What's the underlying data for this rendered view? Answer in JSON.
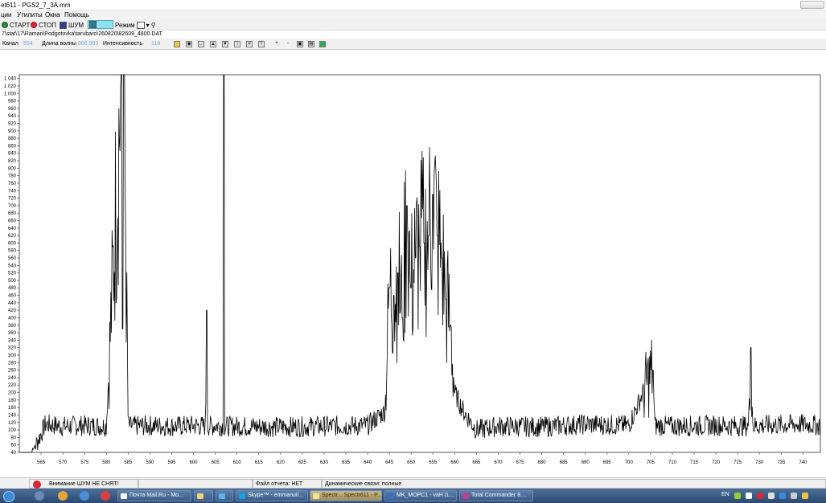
{
  "window": {
    "title": "et611 - PGS2_7_3A.mm"
  },
  "menu": [
    "ции",
    "Утилиты",
    "Окна",
    "Помощь"
  ],
  "toolbar": {
    "start_label": "СТАРТ",
    "stop_label": "СТОП",
    "noise_label": "ШУМ",
    "mode_label": "Режим"
  },
  "path": "7\\stat\\17\\Raman\\Podgotovka\\tarubaro\\260820\\82609_4800.DAT",
  "readout": {
    "channel_label": "Канал",
    "channel_value": "894",
    "wavelength_label": "Длина волны",
    "wavelength_value": "806.983",
    "intensity_label": "Интенсивность",
    "intensity_value": "118"
  },
  "chart_data": {
    "type": "line",
    "title": "",
    "xlabel": "",
    "ylabel": "",
    "xlim": [
      560,
      744
    ],
    "ylim": [
      40,
      1050
    ],
    "x_ticks": [
      565,
      570,
      575,
      580,
      585,
      590,
      595,
      600,
      605,
      610,
      615,
      620,
      625,
      630,
      635,
      640,
      645,
      650,
      655,
      660,
      665,
      670,
      675,
      680,
      685,
      690,
      695,
      700,
      705,
      710,
      715,
      720,
      725,
      730,
      735,
      740
    ],
    "y_ticks": [
      40,
      60,
      80,
      100,
      120,
      140,
      160,
      180,
      200,
      220,
      240,
      260,
      280,
      300,
      320,
      340,
      360,
      380,
      400,
      420,
      440,
      460,
      480,
      500,
      520,
      540,
      560,
      580,
      600,
      620,
      640,
      660,
      680,
      700,
      720,
      740,
      760,
      780,
      800,
      820,
      840,
      860,
      880,
      900,
      920,
      940,
      960,
      980,
      1000,
      1020,
      1040
    ],
    "y_tick_labels": [
      "40",
      "60",
      "80",
      "100",
      "120",
      "140",
      "160",
      "180",
      "200",
      "220",
      "240",
      "260",
      "280",
      "300",
      "320",
      "340",
      "360",
      "380",
      "400",
      "420",
      "440",
      "460",
      "480",
      "500",
      "520",
      "540",
      "560",
      "580",
      "600",
      "620",
      "640",
      "660",
      "680",
      "700",
      "720",
      "740",
      "760",
      "780",
      "800",
      "820",
      "840",
      "860",
      "880",
      "900",
      "920",
      "940",
      "960",
      "980",
      "1 000",
      "1 020",
      "1 040"
    ],
    "grid": false,
    "series": [
      {
        "color": "#000000",
        "baseline": 110,
        "noise_amplitude": 28,
        "x": [
          560,
          563,
          566,
          570,
          575,
          580,
          583.5,
          583.7,
          584,
          585,
          590,
          595,
          600,
          602.8,
          603,
          603.2,
          605,
          606.9,
          607,
          607.1,
          610,
          620,
          630,
          640,
          644,
          645,
          646,
          647,
          648,
          649,
          650,
          651,
          652,
          653,
          654,
          655,
          656,
          657,
          658,
          659,
          660,
          662,
          665,
          670,
          680,
          690,
          700,
          705.5,
          706,
          706.5,
          710,
          720,
          727.5,
          728,
          728.5,
          730,
          740,
          744
        ],
        "y": [
          40,
          40,
          115,
          110,
          112,
          110,
          1050,
          370,
          1050,
          110,
          112,
          110,
          112,
          110,
          420,
          110,
          112,
          110,
          1050,
          110,
          110,
          108,
          110,
          112,
          150,
          480,
          460,
          520,
          400,
          700,
          480,
          560,
          590,
          600,
          620,
          730,
          620,
          560,
          450,
          380,
          200,
          150,
          100,
          110,
          108,
          115,
          112,
          260,
          110,
          112,
          110,
          112,
          110,
          320,
          110,
          112,
          115,
          112
        ]
      }
    ]
  },
  "status": {
    "warning": "Внимание ШУМ НЕ СНЯТ!",
    "report_file": "Файл отчета: НЕТ",
    "dynamic": "Динамические связи: полные"
  },
  "taskbar": {
    "tasks": [
      "Почта Mail.Ru - Mo...",
      "",
      "Skype™ - emmanuil...",
      "Spectr... Spectr611 - P...",
      "MK_MOPC1 - vaH (L...",
      "Total Commander 8...."
    ],
    "lang": "EN"
  },
  "colors": {
    "accent_value": "#7fa9d6",
    "taskbar": "#2a4a72",
    "warning_icon": "#d9262f"
  }
}
